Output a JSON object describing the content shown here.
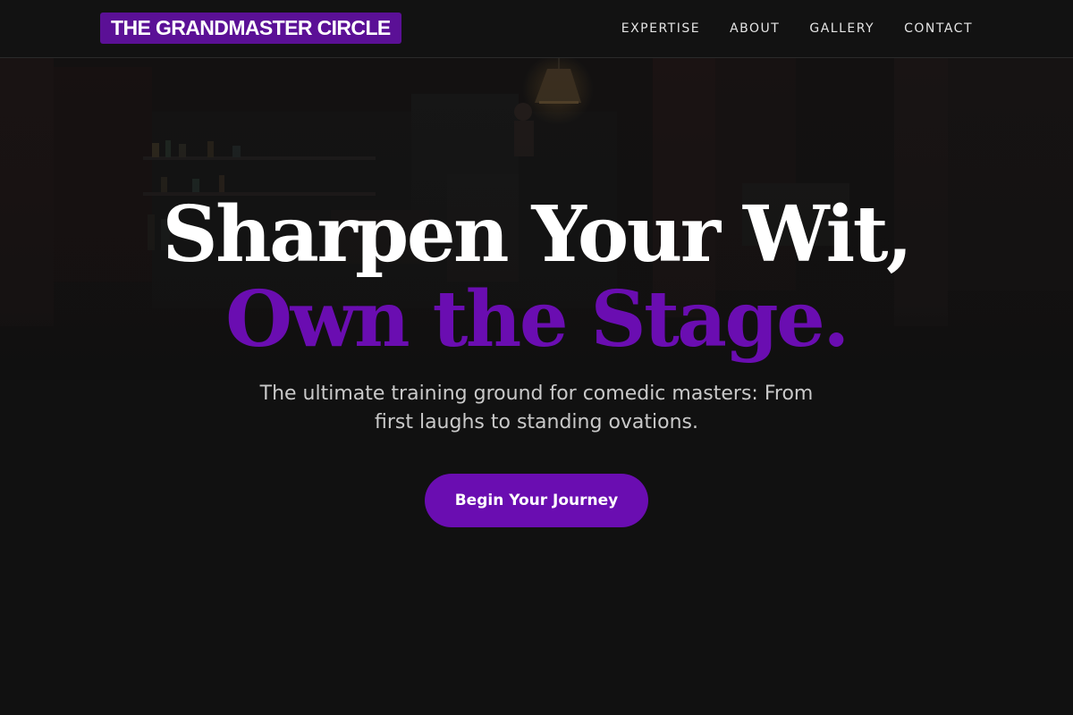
{
  "brand": {
    "name": "THE GRANDMASTER CIRCLE",
    "color": "#5b1096"
  },
  "nav": {
    "items": [
      {
        "label": "EXPERTISE"
      },
      {
        "label": "ABOUT"
      },
      {
        "label": "GALLERY"
      },
      {
        "label": "CONTACT"
      }
    ]
  },
  "hero": {
    "headline_line1": "Sharpen Your Wit,",
    "headline_line2": "Own the Stage.",
    "subtitle": "The ultimate training ground for comedic masters: From first laughs to standing ovations.",
    "cta_label": "Begin Your Journey",
    "accent_color": "#6a0db1",
    "background_image": "dim-comedy-club-interior"
  },
  "colors": {
    "page_background": "#111111",
    "headline_primary": "#ffffff",
    "headline_accent": "#6a0db1",
    "subtitle": "#c9c9c9"
  }
}
